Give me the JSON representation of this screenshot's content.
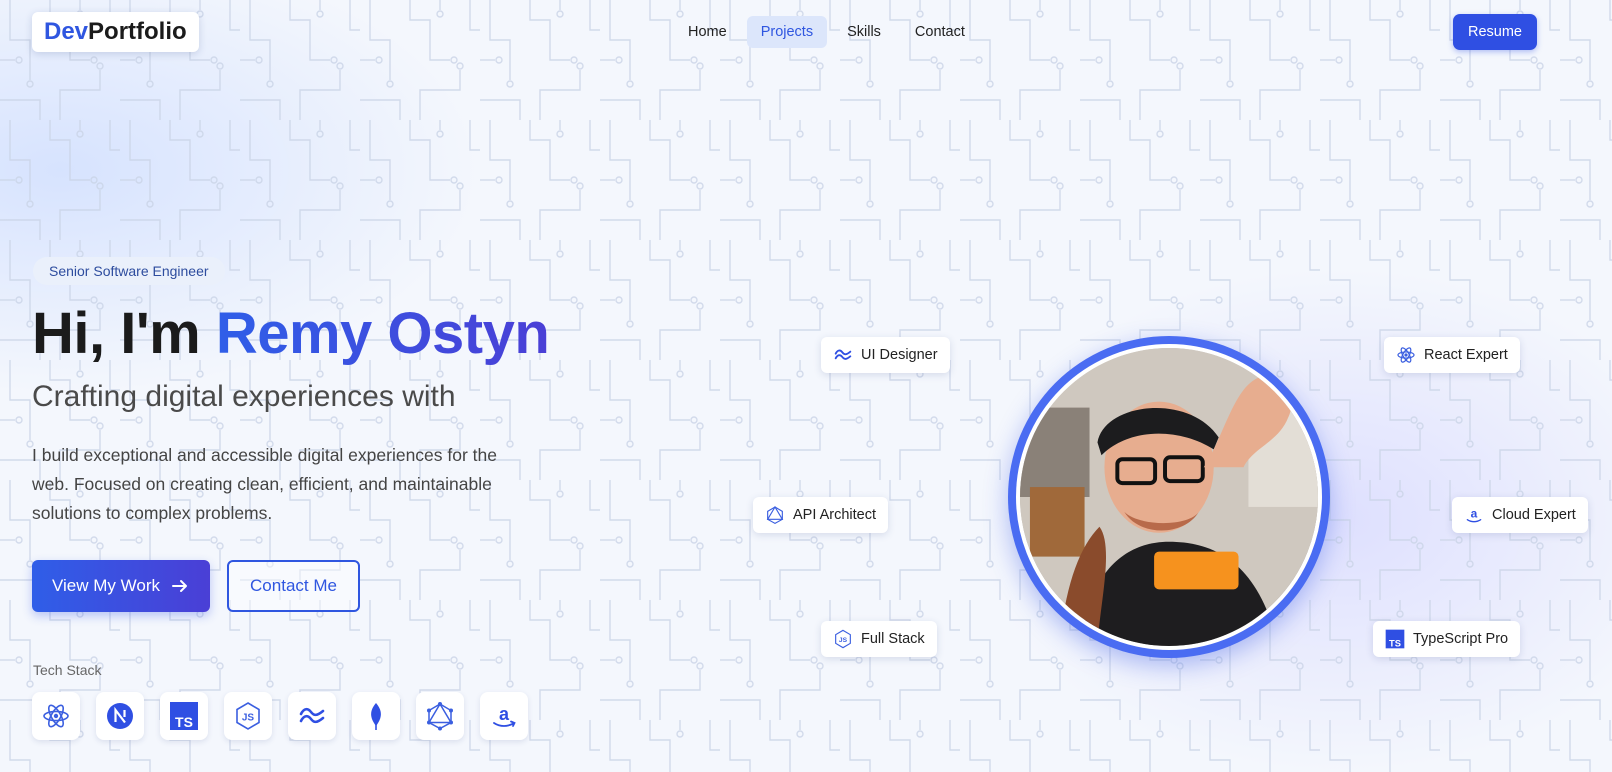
{
  "header": {
    "logo_part1": "Dev",
    "logo_part2": "Portfolio",
    "nav": [
      {
        "label": "Home",
        "active": false
      },
      {
        "label": "Projects",
        "active": true
      },
      {
        "label": "Skills",
        "active": false
      },
      {
        "label": "Contact",
        "active": false
      }
    ],
    "resume_label": "Resume"
  },
  "hero": {
    "badge": "Senior Software Engineer",
    "greeting": "Hi, I'm ",
    "name": "Remy Ostyn",
    "subtitle": "Crafting digital experiences with",
    "description": "I build exceptional and accessible digital experiences for the web. Focused on creating clean, efficient, and maintainable solutions to complex problems.",
    "primary_button": "View My Work",
    "secondary_button": "Contact Me",
    "stack_label": "Tech Stack",
    "stack_icons": [
      "react-icon",
      "nextjs-icon",
      "typescript-icon",
      "javascript-icon",
      "tailwind-icon",
      "mongodb-icon",
      "graphql-icon",
      "amazon-icon"
    ]
  },
  "chips": {
    "ui_designer": "UI Designer",
    "react_expert": "React Expert",
    "api_architect": "API Architect",
    "cloud_expert": "Cloud Expert",
    "full_stack": "Full Stack",
    "typescript_pro": "TypeScript Pro"
  },
  "colors": {
    "accent": "#2f56e0",
    "accent_gradient_end": "#4a3fd6",
    "text_dark": "#1b1b1b",
    "background": "#f4f7fd"
  }
}
